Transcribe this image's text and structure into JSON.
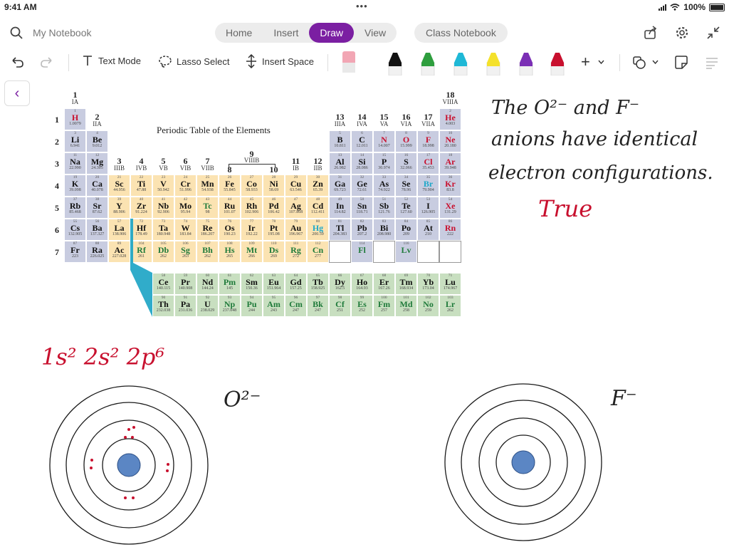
{
  "status": {
    "time": "9:41 AM",
    "battery": "100%",
    "dots": "•••"
  },
  "header": {
    "notebook_title": "My Notebook",
    "tabs": [
      "Home",
      "Insert",
      "Draw",
      "View"
    ],
    "active_tab": "Draw",
    "class_notebook": "Class Notebook"
  },
  "toolbar": {
    "text_mode": "Text Mode",
    "lasso_select": "Lasso Select",
    "insert_space": "Insert Space",
    "plus": "+",
    "pens": [
      {
        "name": "eraser",
        "color": "#f2a6b4"
      },
      {
        "name": "black-pen",
        "color": "#111111"
      },
      {
        "name": "green-pen",
        "color": "#2e9e3e"
      },
      {
        "name": "cyan-pen",
        "color": "#1fb8d6"
      },
      {
        "name": "yellow-highlighter",
        "color": "#f4e12b"
      },
      {
        "name": "purple-pen",
        "color": "#7b2fb5"
      },
      {
        "name": "red-pen",
        "color": "#c8102e"
      }
    ]
  },
  "nav": {
    "back": "‹"
  },
  "ptable": {
    "title": "Periodic Table of the Elements",
    "period_labels": [
      "1",
      "2",
      "3",
      "4",
      "5",
      "6",
      "7"
    ],
    "groups": [
      {
        "col": 1,
        "num": "1",
        "sub": "IA"
      },
      {
        "col": 2,
        "num": "2",
        "sub": "IIA"
      },
      {
        "col": 3,
        "num": "3",
        "sub": "IIIB"
      },
      {
        "col": 4,
        "num": "4",
        "sub": "IVB"
      },
      {
        "col": 5,
        "num": "5",
        "sub": "VB"
      },
      {
        "col": 6,
        "num": "6",
        "sub": "VIB"
      },
      {
        "col": 7,
        "num": "7",
        "sub": "VIIB"
      },
      {
        "col": 8,
        "num": "8",
        "sub": ""
      },
      {
        "col": 9,
        "num": "9",
        "sub": "VIIIB"
      },
      {
        "col": 10,
        "num": "10",
        "sub": ""
      },
      {
        "col": 11,
        "num": "11",
        "sub": "IB"
      },
      {
        "col": 12,
        "num": "12",
        "sub": "IIB"
      },
      {
        "col": 13,
        "num": "13",
        "sub": "IIIA"
      },
      {
        "col": 14,
        "num": "14",
        "sub": "IVA"
      },
      {
        "col": 15,
        "num": "15",
        "sub": "VA"
      },
      {
        "col": 16,
        "num": "16",
        "sub": "VIA"
      },
      {
        "col": 17,
        "num": "17",
        "sub": "VIIA"
      },
      {
        "col": 18,
        "num": "18",
        "sub": "VIIIA"
      }
    ],
    "elements": [
      [
        1,
        "H",
        "1.0079",
        1,
        1,
        "s",
        "red"
      ],
      [
        2,
        "He",
        "4.003",
        1,
        18,
        "p",
        "red"
      ],
      [
        3,
        "Li",
        "6.941",
        2,
        1,
        "s",
        "black"
      ],
      [
        4,
        "Be",
        "9.012",
        2,
        2,
        "s",
        "black"
      ],
      [
        5,
        "B",
        "10.811",
        2,
        13,
        "p",
        "black"
      ],
      [
        6,
        "C",
        "12.011",
        2,
        14,
        "p",
        "black"
      ],
      [
        7,
        "N",
        "14.007",
        2,
        15,
        "p",
        "red"
      ],
      [
        8,
        "O",
        "15.999",
        2,
        16,
        "p",
        "red"
      ],
      [
        9,
        "F",
        "18.998",
        2,
        17,
        "p",
        "red"
      ],
      [
        10,
        "Ne",
        "20.180",
        2,
        18,
        "p",
        "red"
      ],
      [
        11,
        "Na",
        "22.990",
        3,
        1,
        "s",
        "black"
      ],
      [
        12,
        "Mg",
        "24.305",
        3,
        2,
        "s",
        "black"
      ],
      [
        13,
        "Al",
        "26.982",
        3,
        13,
        "p",
        "black"
      ],
      [
        14,
        "Si",
        "28.086",
        3,
        14,
        "p",
        "black"
      ],
      [
        15,
        "P",
        "30.974",
        3,
        15,
        "p",
        "black"
      ],
      [
        16,
        "S",
        "32.066",
        3,
        16,
        "p",
        "black"
      ],
      [
        17,
        "Cl",
        "35.453",
        3,
        17,
        "p",
        "red"
      ],
      [
        18,
        "Ar",
        "39.948",
        3,
        18,
        "p",
        "red"
      ],
      [
        19,
        "K",
        "39.098",
        4,
        1,
        "s",
        "black"
      ],
      [
        20,
        "Ca",
        "40.078",
        4,
        2,
        "s",
        "black"
      ],
      [
        21,
        "Sc",
        "44.956",
        4,
        3,
        "d",
        "black"
      ],
      [
        22,
        "Ti",
        "47.88",
        4,
        4,
        "d",
        "black"
      ],
      [
        23,
        "V",
        "50.942",
        4,
        5,
        "d",
        "black"
      ],
      [
        24,
        "Cr",
        "51.996",
        4,
        6,
        "d",
        "black"
      ],
      [
        25,
        "Mn",
        "54.938",
        4,
        7,
        "d",
        "black"
      ],
      [
        26,
        "Fe",
        "55.845",
        4,
        8,
        "d",
        "black"
      ],
      [
        27,
        "Co",
        "58.933",
        4,
        9,
        "d",
        "black"
      ],
      [
        28,
        "Ni",
        "58.69",
        4,
        10,
        "d",
        "black"
      ],
      [
        29,
        "Cu",
        "63.546",
        4,
        11,
        "d",
        "black"
      ],
      [
        30,
        "Zn",
        "65.39",
        4,
        12,
        "d",
        "black"
      ],
      [
        31,
        "Ga",
        "69.723",
        4,
        13,
        "p",
        "black"
      ],
      [
        32,
        "Ge",
        "72.61",
        4,
        14,
        "p",
        "black"
      ],
      [
        33,
        "As",
        "74.922",
        4,
        15,
        "p",
        "black"
      ],
      [
        34,
        "Se",
        "78.96",
        4,
        16,
        "p",
        "black"
      ],
      [
        35,
        "Br",
        "79.904",
        4,
        17,
        "p",
        "cyan"
      ],
      [
        36,
        "Kr",
        "83.8",
        4,
        18,
        "p",
        "red"
      ],
      [
        37,
        "Rb",
        "85.468",
        5,
        1,
        "s",
        "black"
      ],
      [
        38,
        "Sr",
        "87.62",
        5,
        2,
        "s",
        "black"
      ],
      [
        39,
        "Y",
        "88.906",
        5,
        3,
        "d",
        "black"
      ],
      [
        40,
        "Zr",
        "91.224",
        5,
        4,
        "d",
        "black"
      ],
      [
        41,
        "Nb",
        "92.906",
        5,
        5,
        "d",
        "black"
      ],
      [
        42,
        "Mo",
        "95.94",
        5,
        6,
        "d",
        "black"
      ],
      [
        43,
        "Tc",
        "98",
        5,
        7,
        "d",
        "green"
      ],
      [
        44,
        "Ru",
        "101.07",
        5,
        8,
        "d",
        "black"
      ],
      [
        45,
        "Rh",
        "102.906",
        5,
        9,
        "d",
        "black"
      ],
      [
        46,
        "Pd",
        "106.42",
        5,
        10,
        "d",
        "black"
      ],
      [
        47,
        "Ag",
        "107.868",
        5,
        11,
        "d",
        "black"
      ],
      [
        48,
        "Cd",
        "112.411",
        5,
        12,
        "d",
        "black"
      ],
      [
        49,
        "In",
        "114.82",
        5,
        13,
        "p",
        "black"
      ],
      [
        50,
        "Sn",
        "118.71",
        5,
        14,
        "p",
        "black"
      ],
      [
        51,
        "Sb",
        "121.76",
        5,
        15,
        "p",
        "black"
      ],
      [
        52,
        "Te",
        "127.60",
        5,
        16,
        "p",
        "black"
      ],
      [
        53,
        "I",
        "126.905",
        5,
        17,
        "p",
        "black"
      ],
      [
        54,
        "Xe",
        "131.29",
        5,
        18,
        "p",
        "red"
      ],
      [
        55,
        "Cs",
        "132.905",
        6,
        1,
        "s",
        "black"
      ],
      [
        56,
        "Ba",
        "137.327",
        6,
        2,
        "s",
        "black"
      ],
      [
        57,
        "La",
        "138.906",
        6,
        3,
        "d",
        "black"
      ],
      [
        72,
        "Hf",
        "178.49",
        6,
        4,
        "d",
        "black"
      ],
      [
        73,
        "Ta",
        "180.948",
        6,
        5,
        "d",
        "black"
      ],
      [
        74,
        "W",
        "183.84",
        6,
        6,
        "d",
        "black"
      ],
      [
        75,
        "Re",
        "186.207",
        6,
        7,
        "d",
        "black"
      ],
      [
        76,
        "Os",
        "190.23",
        6,
        8,
        "d",
        "black"
      ],
      [
        77,
        "Ir",
        "192.22",
        6,
        9,
        "d",
        "black"
      ],
      [
        78,
        "Pt",
        "195.08",
        6,
        10,
        "d",
        "black"
      ],
      [
        79,
        "Au",
        "196.967",
        6,
        11,
        "d",
        "black"
      ],
      [
        80,
        "Hg",
        "200.59",
        6,
        12,
        "d",
        "cyan"
      ],
      [
        81,
        "Tl",
        "204.383",
        6,
        13,
        "p",
        "black"
      ],
      [
        82,
        "Pb",
        "207.2",
        6,
        14,
        "p",
        "black"
      ],
      [
        83,
        "Bi",
        "208.980",
        6,
        15,
        "p",
        "black"
      ],
      [
        84,
        "Po",
        "209",
        6,
        16,
        "p",
        "black"
      ],
      [
        85,
        "At",
        "210",
        6,
        17,
        "p",
        "black"
      ],
      [
        86,
        "Rn",
        "222",
        6,
        18,
        "p",
        "red"
      ],
      [
        87,
        "Fr",
        "223",
        7,
        1,
        "s",
        "black"
      ],
      [
        88,
        "Ra",
        "226.025",
        7,
        2,
        "s",
        "black"
      ],
      [
        89,
        "Ac",
        "227.028",
        7,
        3,
        "d",
        "black"
      ],
      [
        104,
        "Rf",
        "261",
        7,
        4,
        "d",
        "green"
      ],
      [
        105,
        "Db",
        "262",
        7,
        5,
        "d",
        "green"
      ],
      [
        106,
        "Sg",
        "263",
        7,
        6,
        "d",
        "green"
      ],
      [
        107,
        "Bh",
        "262",
        7,
        7,
        "d",
        "green"
      ],
      [
        108,
        "Hs",
        "265",
        7,
        8,
        "d",
        "green"
      ],
      [
        109,
        "Mt",
        "266",
        7,
        9,
        "d",
        "green"
      ],
      [
        110,
        "Ds",
        "269",
        7,
        10,
        "d",
        "green"
      ],
      [
        111,
        "Rg",
        "272",
        7,
        11,
        "d",
        "green"
      ],
      [
        112,
        "Cn",
        "277",
        7,
        12,
        "d",
        "green"
      ],
      [
        null,
        "",
        "",
        7,
        13,
        "e",
        "black"
      ],
      [
        114,
        "Fl",
        "",
        7,
        14,
        "p",
        "green"
      ],
      [
        null,
        "",
        "",
        7,
        15,
        "e",
        "black"
      ],
      [
        116,
        "Lv",
        "",
        7,
        16,
        "p",
        "green"
      ],
      [
        null,
        "",
        "",
        7,
        17,
        "e",
        "black"
      ],
      [
        null,
        "",
        "",
        7,
        18,
        "e",
        "black"
      ]
    ],
    "lanthanides": [
      [
        58,
        "Ce",
        "140.115",
        "black"
      ],
      [
        59,
        "Pr",
        "140.908",
        "black"
      ],
      [
        60,
        "Nd",
        "144.24",
        "black"
      ],
      [
        61,
        "Pm",
        "145",
        "green"
      ],
      [
        62,
        "Sm",
        "150.36",
        "black"
      ],
      [
        63,
        "Eu",
        "151.964",
        "black"
      ],
      [
        64,
        "Gd",
        "157.25",
        "black"
      ],
      [
        65,
        "Tb",
        "158.925",
        "black"
      ],
      [
        66,
        "Dy",
        "162.5",
        "black"
      ],
      [
        67,
        "Ho",
        "164.93",
        "black"
      ],
      [
        68,
        "Er",
        "167.26",
        "black"
      ],
      [
        69,
        "Tm",
        "168.934",
        "black"
      ],
      [
        70,
        "Yb",
        "173.04",
        "black"
      ],
      [
        71,
        "Lu",
        "174.967",
        "black"
      ]
    ],
    "actinides": [
      [
        90,
        "Th",
        "232.038",
        "black"
      ],
      [
        91,
        "Pa",
        "231.036",
        "black"
      ],
      [
        92,
        "U",
        "238.029",
        "black"
      ],
      [
        93,
        "Np",
        "237.048",
        "green"
      ],
      [
        94,
        "Pu",
        "244",
        "green"
      ],
      [
        95,
        "Am",
        "243",
        "green"
      ],
      [
        96,
        "Cm",
        "247",
        "green"
      ],
      [
        97,
        "Bk",
        "247",
        "green"
      ],
      [
        98,
        "Cf",
        "251",
        "green"
      ],
      [
        99,
        "Es",
        "252",
        "green"
      ],
      [
        100,
        "Fm",
        "257",
        "green"
      ],
      [
        101,
        "Md",
        "258",
        "green"
      ],
      [
        102,
        "No",
        "259",
        "green"
      ],
      [
        103,
        "Lr",
        "262",
        "green"
      ]
    ],
    "colors": {
      "s": "#c8cce0",
      "p": "#c8cce0",
      "d": "#fbe3b2",
      "f": "#c8dfc0",
      "e": "#ffffff",
      "red": "#c8102e",
      "green": "#1f7a3a",
      "cyan": "#1fa8c9",
      "black": "#111111"
    }
  },
  "notes": {
    "statement_lines": [
      "The O²⁻ and F⁻",
      "anions have identical",
      "electron configurations."
    ],
    "answer": "True",
    "config": "1s² 2s² 2p⁶",
    "ion1": "O²⁻",
    "ion2": "F⁻",
    "ink_colors": {
      "black": "#1a1a1a",
      "red": "#c8102e",
      "nucleus": "#5b86c4"
    }
  }
}
